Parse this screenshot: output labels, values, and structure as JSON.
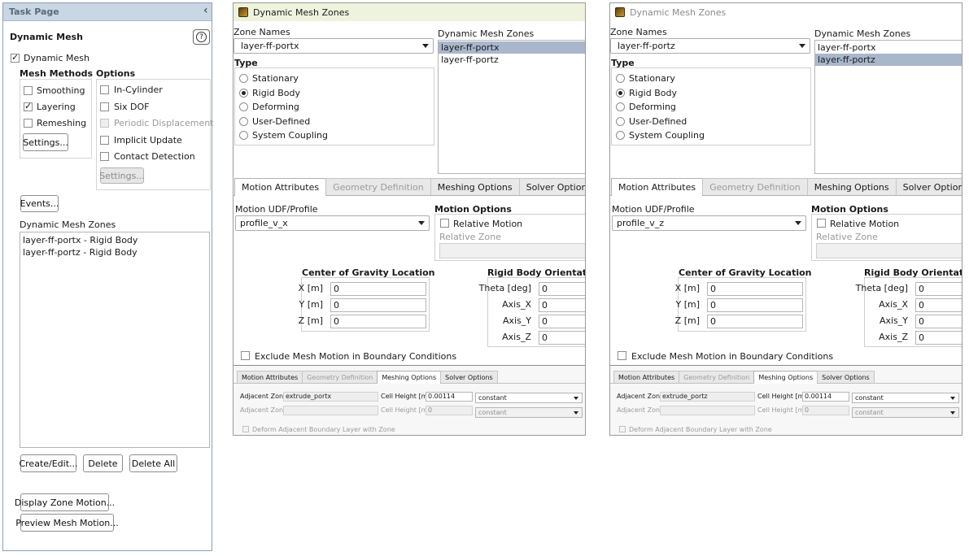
{
  "task_page": {
    "header": "Task Page",
    "collapse_glyph": "‹",
    "title": "Dynamic Mesh",
    "help_glyph": "?",
    "dynamic_mesh_label": "Dynamic Mesh",
    "dynamic_mesh_checked": true,
    "mesh_methods_title": "Mesh Methods",
    "mesh_methods": [
      {
        "label": "Smoothing",
        "checked": false
      },
      {
        "label": "Layering",
        "checked": true
      },
      {
        "label": "Remeshing",
        "checked": false
      }
    ],
    "mesh_settings_button": "Settings...",
    "options_title": "Options",
    "options": [
      {
        "label": "In-Cylinder",
        "checked": false,
        "disabled": false
      },
      {
        "label": "Six DOF",
        "checked": false,
        "disabled": false
      },
      {
        "label": "Periodic Displacement",
        "checked": false,
        "disabled": true
      },
      {
        "label": "Implicit Update",
        "checked": false,
        "disabled": false
      },
      {
        "label": "Contact Detection",
        "checked": false,
        "disabled": false
      }
    ],
    "options_settings_button": "Settings...",
    "events_button": "Events...",
    "zones_title": "Dynamic Mesh Zones",
    "zones": [
      "layer-ff-portx - Rigid Body",
      "layer-ff-portz - Rigid Body"
    ],
    "create_edit_button": "Create/Edit...",
    "delete_button": "Delete",
    "delete_all_button": "Delete All",
    "display_zone_motion_button": "Display Zone Motion...",
    "preview_mesh_motion_button": "Preview Mesh Motion..."
  },
  "dialogs": [
    {
      "title": "Dynamic Mesh Zones",
      "zone_names_label": "Zone Names",
      "zone_name_value": "layer-ff-portx",
      "list_title": "Dynamic Mesh Zones",
      "list_items": [
        "layer-ff-portx",
        "layer-ff-portz"
      ],
      "selected_index": 0,
      "type_title": "Type",
      "types": [
        "Stationary",
        "Rigid Body",
        "Deforming",
        "User-Defined",
        "System Coupling"
      ],
      "selected_type": 1,
      "tabs": [
        "Motion Attributes",
        "Geometry Definition",
        "Meshing Options",
        "Solver Options"
      ],
      "active_tab": 0,
      "udf_label": "Motion UDF/Profile",
      "udf_value": "profile_v_x",
      "motion_options_title": "Motion Options",
      "relative_motion_label": "Relative Motion",
      "relative_zone_label": "Relative Zone",
      "cog_title": "Center of Gravity Location",
      "cog": [
        {
          "label": "X [m]",
          "value": "0"
        },
        {
          "label": "Y [m]",
          "value": "0"
        },
        {
          "label": "Z [m]",
          "value": "0"
        }
      ],
      "orient_title": "Rigid Body Orientation",
      "orient": [
        {
          "label": "Theta [deg]",
          "value": "0"
        },
        {
          "label": "Axis_X",
          "value": "0"
        },
        {
          "label": "Axis_Y",
          "value": "0"
        },
        {
          "label": "Axis_Z",
          "value": "0"
        }
      ],
      "exclude_label": "Exclude Mesh Motion in Boundary Conditions",
      "inset": {
        "tabs": [
          "Motion Attributes",
          "Geometry Definition",
          "Meshing Options",
          "Solver Options"
        ],
        "active_tab": 2,
        "adjacent_zone_label": "Adjacent Zone",
        "adjacent_zone_value": "extrude_portx",
        "cell_height_label": "Cell Height [m]",
        "cell_height_value": "0.00114",
        "method_value": "constant",
        "adjacent_zone_label_2": "Adjacent Zone",
        "adjacent_zone_value_2": "",
        "cell_height_label_2": "Cell Height [m]",
        "cell_height_value_2": "0",
        "method_value_2": "constant",
        "deform_label": "Deform Adjacent Boundary Layer with Zone"
      }
    },
    {
      "title": "Dynamic Mesh Zones",
      "zone_names_label": "Zone Names",
      "zone_name_value": "layer-ff-portz",
      "list_title": "Dynamic Mesh Zones",
      "list_items": [
        "layer-ff-portx",
        "layer-ff-portz"
      ],
      "selected_index": 1,
      "type_title": "Type",
      "types": [
        "Stationary",
        "Rigid Body",
        "Deforming",
        "User-Defined",
        "System Coupling"
      ],
      "selected_type": 1,
      "tabs": [
        "Motion Attributes",
        "Geometry Definition",
        "Meshing Options",
        "Solver Options"
      ],
      "active_tab": 0,
      "udf_label": "Motion UDF/Profile",
      "udf_value": "profile_v_z",
      "motion_options_title": "Motion Options",
      "relative_motion_label": "Relative Motion",
      "relative_zone_label": "Relative Zone",
      "cog_title": "Center of Gravity Location",
      "cog": [
        {
          "label": "X [m]",
          "value": "0"
        },
        {
          "label": "Y [m]",
          "value": "0"
        },
        {
          "label": "Z [m]",
          "value": "0"
        }
      ],
      "orient_title": "Rigid Body Orientation",
      "orient": [
        {
          "label": "Theta [deg]",
          "value": "0"
        },
        {
          "label": "Axis_X",
          "value": "0"
        },
        {
          "label": "Axis_Y",
          "value": "0"
        },
        {
          "label": "Axis_Z",
          "value": "0"
        }
      ],
      "exclude_label": "Exclude Mesh Motion in Boundary Conditions",
      "inset": {
        "tabs": [
          "Motion Attributes",
          "Geometry Definition",
          "Meshing Options",
          "Solver Options"
        ],
        "active_tab": 2,
        "adjacent_zone_label": "Adjacent Zone",
        "adjacent_zone_value": "extrude_portz",
        "cell_height_label": "Cell Height [m]",
        "cell_height_value": "0.00114",
        "method_value": "constant",
        "adjacent_zone_label_2": "Adjacent Zone",
        "adjacent_zone_value_2": "",
        "cell_height_label_2": "Cell Height [m]",
        "cell_height_value_2": "0",
        "method_value_2": "constant",
        "deform_label": "Deform Adjacent Boundary Layer with Zone"
      }
    }
  ]
}
